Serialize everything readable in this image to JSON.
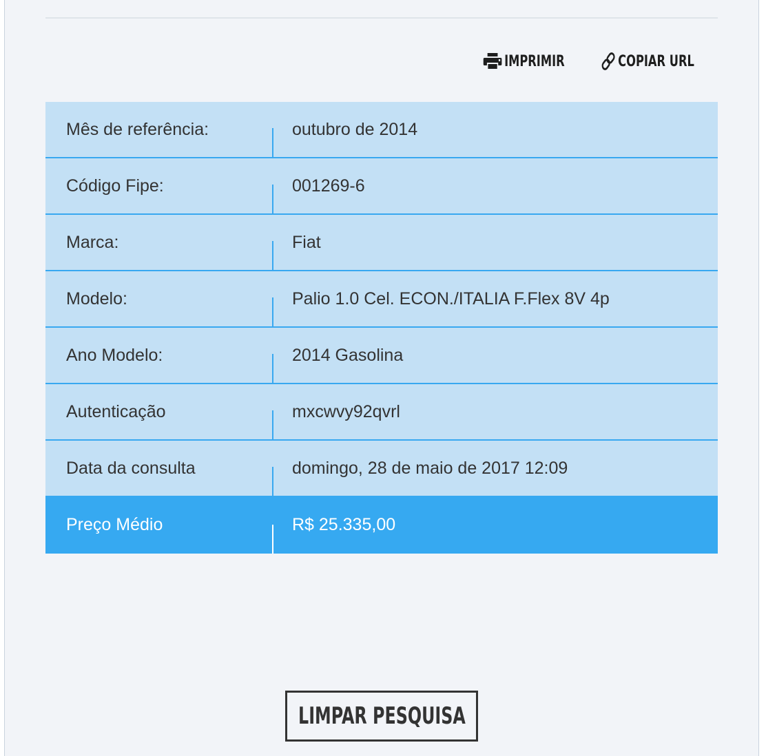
{
  "actions": {
    "print_label": "IMPRIMIR",
    "copy_url_label": "COPIAR URL",
    "print_icon": "printer-icon",
    "copy_icon": "link-icon"
  },
  "results": {
    "rows": [
      {
        "label": "Mês de referência:",
        "value": "outubro de 2014"
      },
      {
        "label": "Código Fipe:",
        "value": "001269-6"
      },
      {
        "label": "Marca:",
        "value": "Fiat"
      },
      {
        "label": "Modelo:",
        "value": "Palio 1.0 Cel. ECON./ITALIA F.Flex 8V 4p"
      },
      {
        "label": "Ano Modelo:",
        "value": "2014 Gasolina"
      },
      {
        "label": "Autenticação",
        "value": "mxcwvy92qvrl"
      },
      {
        "label": "Data da consulta",
        "value": "domingo, 28 de maio de 2017 12:09"
      }
    ],
    "price": {
      "label": "Preço Médio",
      "value": "R$ 25.335,00"
    }
  },
  "footer": {
    "clear_label": "LIMPAR PESQUISA"
  },
  "colors": {
    "row_background": "#c3e0f5",
    "row_border": "#38a8f0",
    "highlight_background": "#36a9f1",
    "page_background": "#f2f4f8",
    "text": "#333333"
  }
}
